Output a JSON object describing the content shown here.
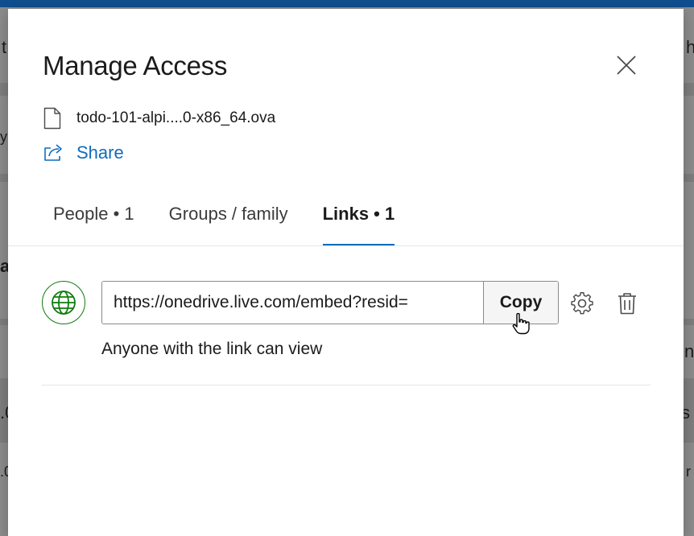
{
  "background": {
    "fragments": [
      "t",
      "h",
      "y",
      "al",
      "na",
      ".0",
      "s s",
      ".0",
      "r"
    ]
  },
  "dialog": {
    "title": "Manage Access",
    "file": {
      "name": "todo-101-alpi....0-x86_64.ova",
      "icon": "document-icon"
    },
    "share": {
      "label": "Share",
      "icon": "share-icon"
    },
    "tabs": [
      {
        "label": "People • 1",
        "active": false
      },
      {
        "label": "Groups / family",
        "active": false
      },
      {
        "label": "Links • 1",
        "active": true
      }
    ],
    "link": {
      "icon": "globe-icon",
      "url": "https://onedrive.live.com/embed?resid=",
      "copy_label": "Copy",
      "description": "Anyone with the link can view",
      "settings_icon": "gear-icon",
      "delete_icon": "trash-icon"
    }
  },
  "colors": {
    "accent": "#0f6cbd",
    "globe_green": "#107c10",
    "topbar": "#0f4f8f"
  }
}
